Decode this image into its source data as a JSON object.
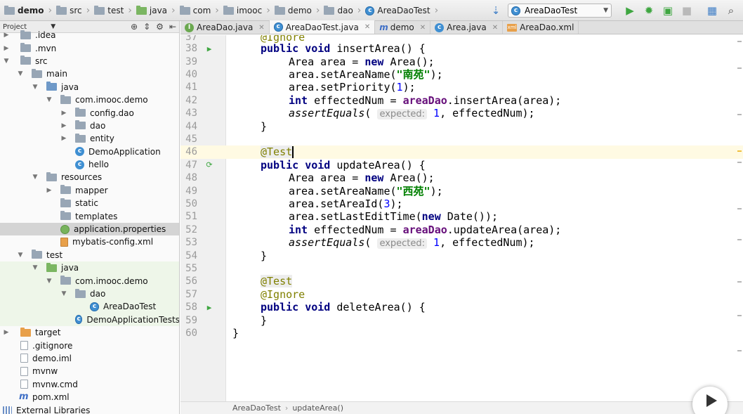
{
  "navbar": {
    "crumbs": [
      {
        "label": "demo",
        "icon": "folder"
      },
      {
        "label": "src",
        "icon": "folder"
      },
      {
        "label": "test",
        "icon": "folder"
      },
      {
        "label": "java",
        "icon": "folder-test"
      },
      {
        "label": "com",
        "icon": "folder"
      },
      {
        "label": "imooc",
        "icon": "folder"
      },
      {
        "label": "demo",
        "icon": "folder"
      },
      {
        "label": "dao",
        "icon": "folder"
      },
      {
        "label": "AreaDaoTest",
        "icon": "class"
      }
    ],
    "run_config": "AreaDaoTest",
    "class_glyph": "c"
  },
  "sidebar": {
    "title": "Project",
    "items": [
      {
        "label": ".idea"
      },
      {
        "label": ".mvn"
      },
      {
        "label": "src"
      },
      {
        "label": "main"
      },
      {
        "label": "java"
      },
      {
        "label": "com.imooc.demo"
      },
      {
        "label": "config.dao"
      },
      {
        "label": "dao"
      },
      {
        "label": "entity"
      },
      {
        "label": "DemoApplication"
      },
      {
        "label": "hello"
      },
      {
        "label": "resources"
      },
      {
        "label": "mapper"
      },
      {
        "label": "static"
      },
      {
        "label": "templates"
      },
      {
        "label": "application.properties"
      },
      {
        "label": "mybatis-config.xml"
      },
      {
        "label": "test"
      },
      {
        "label": "java"
      },
      {
        "label": "com.imooc.demo"
      },
      {
        "label": "dao"
      },
      {
        "label": "AreaDaoTest"
      },
      {
        "label": "DemoApplicationTests"
      },
      {
        "label": "target"
      },
      {
        "label": ".gitignore"
      },
      {
        "label": "demo.iml"
      },
      {
        "label": "mvnw"
      },
      {
        "label": "mvnw.cmd"
      },
      {
        "label": "pom.xml"
      },
      {
        "label": "External Libraries"
      }
    ]
  },
  "tabs": [
    {
      "label": "AreaDao.java",
      "glyph": "I"
    },
    {
      "label": "AreaDaoTest.java",
      "glyph": "c"
    },
    {
      "label": "demo",
      "glyph": "m"
    },
    {
      "label": "Area.java",
      "glyph": "c"
    },
    {
      "label": "AreaDao.xml",
      "glyph": "xml"
    }
  ],
  "editor": {
    "lines": [
      {
        "n": "37",
        "t": "@Ignore"
      },
      {
        "n": "38",
        "t1": "public void ",
        "t2": "insertArea() {"
      },
      {
        "n": "39",
        "t1": "Area area = ",
        "kw": "new",
        "t2": " Area();"
      },
      {
        "n": "40",
        "t1": "area.setAreaName(",
        "s": "\"南苑\"",
        "t2": ");"
      },
      {
        "n": "41",
        "t1": "area.setPriority(",
        "num": "1",
        "t2": ");"
      },
      {
        "n": "42",
        "kw": "int",
        "t1": " effectedNum = ",
        "fld": "areaDao",
        "t2": ".insertArea(area);"
      },
      {
        "n": "43",
        "it": "assertEquals",
        "t1": "( ",
        "hint": "expected:",
        "num": " 1",
        "t2": ", effectedNum);"
      },
      {
        "n": "44",
        "t": "}"
      },
      {
        "n": "45",
        "t": ""
      },
      {
        "n": "46",
        "t": "@Test"
      },
      {
        "n": "47",
        "t1": "public void ",
        "t2": "updateArea() {"
      },
      {
        "n": "48",
        "t1": "Area area = ",
        "kw": "new",
        "t2": " Area();"
      },
      {
        "n": "49",
        "t1": "area.setAreaName(",
        "s": "\"西苑\"",
        "t2": ");"
      },
      {
        "n": "50",
        "t1": "area.setAreaId(",
        "num": "3",
        "t2": ");"
      },
      {
        "n": "51",
        "t1": "area.setLastEditTime(",
        "kw": "new",
        "t2": " Date());"
      },
      {
        "n": "52",
        "kw": "int",
        "t1": " effectedNum = ",
        "fld": "areaDao",
        "t2": ".updateArea(area);"
      },
      {
        "n": "53",
        "it": "assertEquals",
        "t1": "( ",
        "hint": "expected:",
        "num": " 1",
        "t2": ", effectedNum);"
      },
      {
        "n": "54",
        "t": "}"
      },
      {
        "n": "55",
        "t": ""
      },
      {
        "n": "56",
        "t": "@Test"
      },
      {
        "n": "57",
        "t": "@Ignore"
      },
      {
        "n": "58",
        "t1": "public void ",
        "t2": "deleteArea() {"
      },
      {
        "n": "59",
        "t": "}"
      },
      {
        "n": "60",
        "t": "}"
      }
    ]
  },
  "footer": {
    "crumbs": [
      "AreaDaoTest",
      "updateArea()"
    ]
  },
  "colors": {
    "keyword": "#000080",
    "string": "#008000",
    "number": "#0000ff",
    "annotation": "#808000",
    "field": "#660e7a",
    "run_green": "#3ea640"
  }
}
